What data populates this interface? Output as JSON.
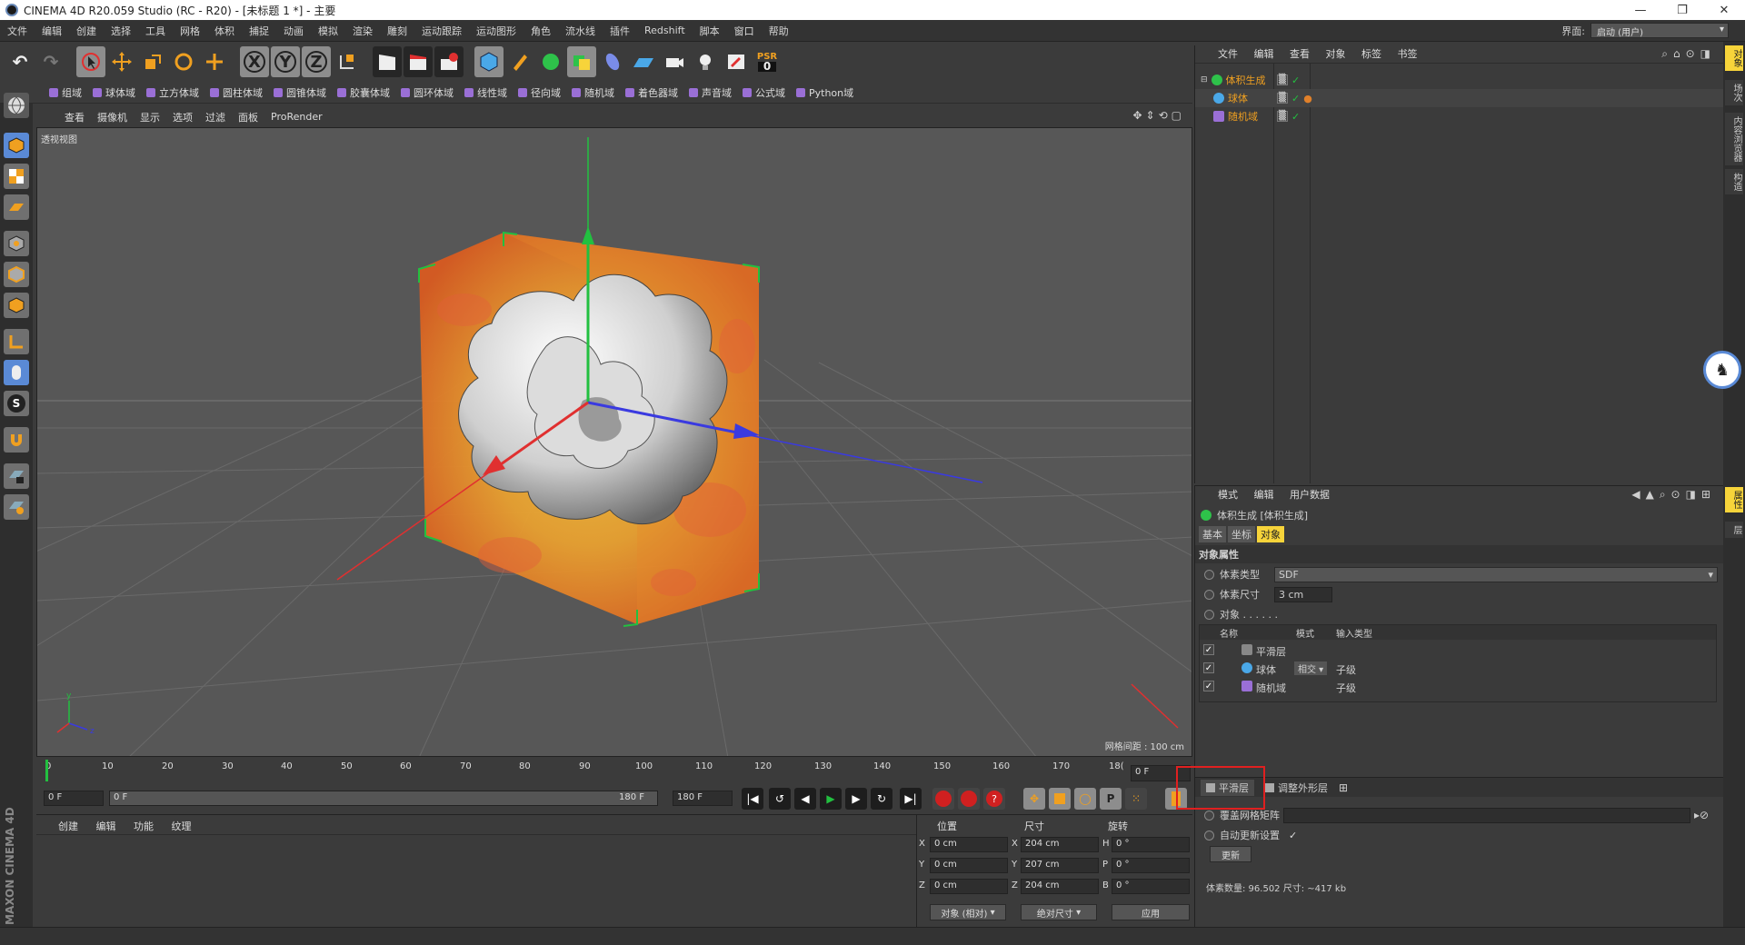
{
  "title": "CINEMA 4D R20.059 Studio (RC - R20) - [未标题 1 *] - 主要",
  "menu": [
    "文件",
    "编辑",
    "创建",
    "选择",
    "工具",
    "网格",
    "体积",
    "捕捉",
    "动画",
    "模拟",
    "渲染",
    "雕刻",
    "运动跟踪",
    "运动图形",
    "角色",
    "流水线",
    "插件",
    "Redshift",
    "脚本",
    "窗口",
    "帮助"
  ],
  "layout_label": "界面:",
  "layout_value": "启动 (用户)",
  "toolbar": {
    "xyz": [
      "X",
      "Y",
      "Z"
    ],
    "psr": "PSR",
    "psr_value": "0"
  },
  "fields": [
    "组域",
    "球体域",
    "立方体域",
    "圆柱体域",
    "圆锥体域",
    "胶囊体域",
    "圆环体域",
    "线性域",
    "径向域",
    "随机域",
    "着色器域",
    "声音域",
    "公式域",
    "Python域"
  ],
  "viewport_menu": [
    "查看",
    "摄像机",
    "显示",
    "选项",
    "过滤",
    "面板",
    "ProRender"
  ],
  "viewport_label": "透视视图",
  "grid_info": "网格间距 : 100 cm",
  "timeline_ticks": [
    "0",
    "10",
    "20",
    "30",
    "40",
    "50",
    "60",
    "70",
    "80",
    "90",
    "100",
    "110",
    "120",
    "130",
    "140",
    "150",
    "160",
    "170",
    "18("
  ],
  "frame_current": "0 F",
  "transport": {
    "start": "0 F",
    "slider_start": "0 F",
    "slider_end": "180 F",
    "end": "180 F"
  },
  "material_menu": [
    "创建",
    "编辑",
    "功能",
    "纹理"
  ],
  "coords": {
    "headers": [
      "位置",
      "尺寸",
      "旋转"
    ],
    "rows": [
      {
        "axis": "X",
        "pos": "0 cm",
        "size_axis": "X",
        "size": "204 cm",
        "rot_axis": "H",
        "rot": "0 °"
      },
      {
        "axis": "Y",
        "pos": "0 cm",
        "size_axis": "Y",
        "size": "207 cm",
        "rot_axis": "P",
        "rot": "0 °"
      },
      {
        "axis": "Z",
        "pos": "0 cm",
        "size_axis": "Z",
        "size": "204 cm",
        "rot_axis": "B",
        "rot": "0 °"
      }
    ],
    "mode1": "对象 (相对)",
    "mode2": "绝对尺寸",
    "apply": "应用"
  },
  "object_manager": {
    "menu": [
      "文件",
      "编辑",
      "查看",
      "对象",
      "标签",
      "书签"
    ],
    "items": [
      {
        "name": "体积生成",
        "color": "#f0a020",
        "indent": 0
      },
      {
        "name": "球体",
        "color": "#f0a020",
        "indent": 1
      },
      {
        "name": "随机域",
        "color": "#f0a020",
        "indent": 1
      }
    ]
  },
  "attribute_manager": {
    "menu": [
      "模式",
      "编辑",
      "用户数据"
    ],
    "object_title": "体积生成 [体积生成]",
    "tabs": [
      "基本",
      "坐标",
      "对象"
    ],
    "section": "对象属性",
    "voxel_type_label": "体素类型",
    "voxel_type_value": "SDF",
    "voxel_size_label": "体素尺寸",
    "voxel_size_value": "3 cm",
    "objects_label": "对象 . . . . . .",
    "list_headers": [
      "名称",
      "模式",
      "输入类型"
    ],
    "list_rows": [
      {
        "name": "平滑层",
        "mode": "",
        "type": ""
      },
      {
        "name": "球体",
        "mode": "相交",
        "type": "子级"
      },
      {
        "name": "随机域",
        "mode": "",
        "type": "子级"
      }
    ],
    "sub_tabs": [
      "平滑层",
      "调整外形层"
    ],
    "override_label": "覆盖网格矩阵",
    "auto_update_label": "自动更新设置",
    "update_button": "更新",
    "stats": "体素数量: 96.502  尺寸: ~417 kb"
  },
  "right_tabs": [
    "对象",
    "场次",
    "内容浏览器",
    "构造",
    "属性",
    "层"
  ],
  "brand": "MAXON CINEMA 4D",
  "colors": {
    "accent_yellow": "#f7d43a",
    "active_blue": "#5a8ad6",
    "highlight_red": "#e02020",
    "orange_text": "#f0a020"
  }
}
